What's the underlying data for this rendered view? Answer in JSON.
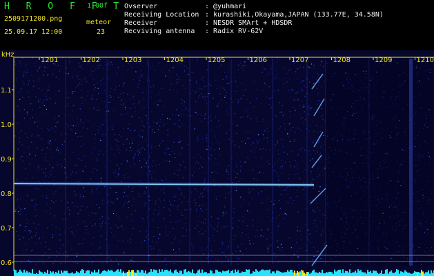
{
  "header": {
    "logo": "H R O F F T",
    "version": "1.00f",
    "filename": "2509171200.png",
    "datetime": "25.09.17 12:00",
    "mode_label": "meteor",
    "count": "23",
    "info": [
      {
        "label": "Ovserver",
        "value": ": @yuhmari"
      },
      {
        "label": "Receiving Location",
        "value": ": kurashiki,Okayama,JAPAN (133.77E, 34.58N)"
      },
      {
        "label": "Receiver",
        "value": ": NESDR SMArt + HDSDR"
      },
      {
        "label": "Recviving antenna",
        "value": ": Radix RV-62V"
      }
    ]
  },
  "plot": {
    "unit_label": "kHz",
    "x_ticks": [
      "1201",
      "1202",
      "1203",
      "1204",
      "1205",
      "1206",
      "1207",
      "1208",
      "1209",
      "1210"
    ],
    "y_ticks": [
      "1.1",
      "1.0",
      "0.9",
      "0.8",
      "0.7",
      "0.6"
    ],
    "colors": {
      "label": "#f5e71a",
      "background": "#0a0a3a",
      "noise": "#2d4bd6",
      "trace": "#9ff0ff",
      "bottom": "#27e3ff",
      "axis": "#f5e71a"
    }
  }
}
